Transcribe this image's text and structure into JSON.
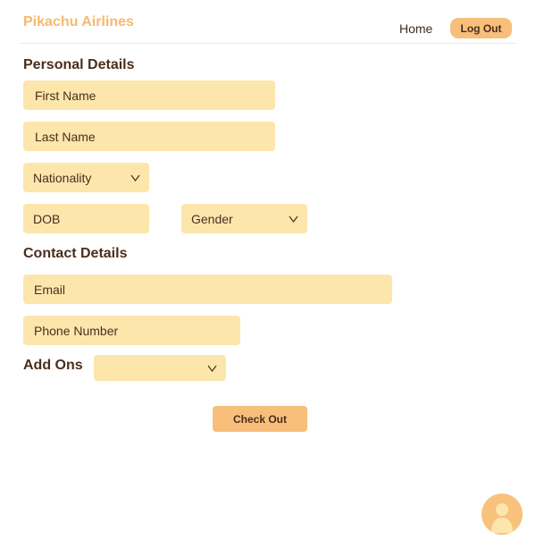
{
  "header": {
    "brand": "Pikachu Airlines",
    "home_link": "Home",
    "logout_label": "Log Out"
  },
  "personal": {
    "title": "Personal Details",
    "first_name": "First Name",
    "last_name": "Last Name",
    "nationality": "Nationality",
    "dob": "DOB",
    "gender": "Gender"
  },
  "contact": {
    "title": "Contact Details",
    "email": "Email",
    "phone": "Phone Number"
  },
  "addons": {
    "title": "Add Ons",
    "selected": ""
  },
  "checkout_label": "Check Out",
  "colors": {
    "accent": "#f7bf7b",
    "brand": "#f6b970",
    "field_bg": "#fde6ac",
    "text": "#4a2e1c"
  },
  "icons": {
    "dropdown": "chevron-down-icon",
    "avatar": "user-avatar-icon"
  }
}
